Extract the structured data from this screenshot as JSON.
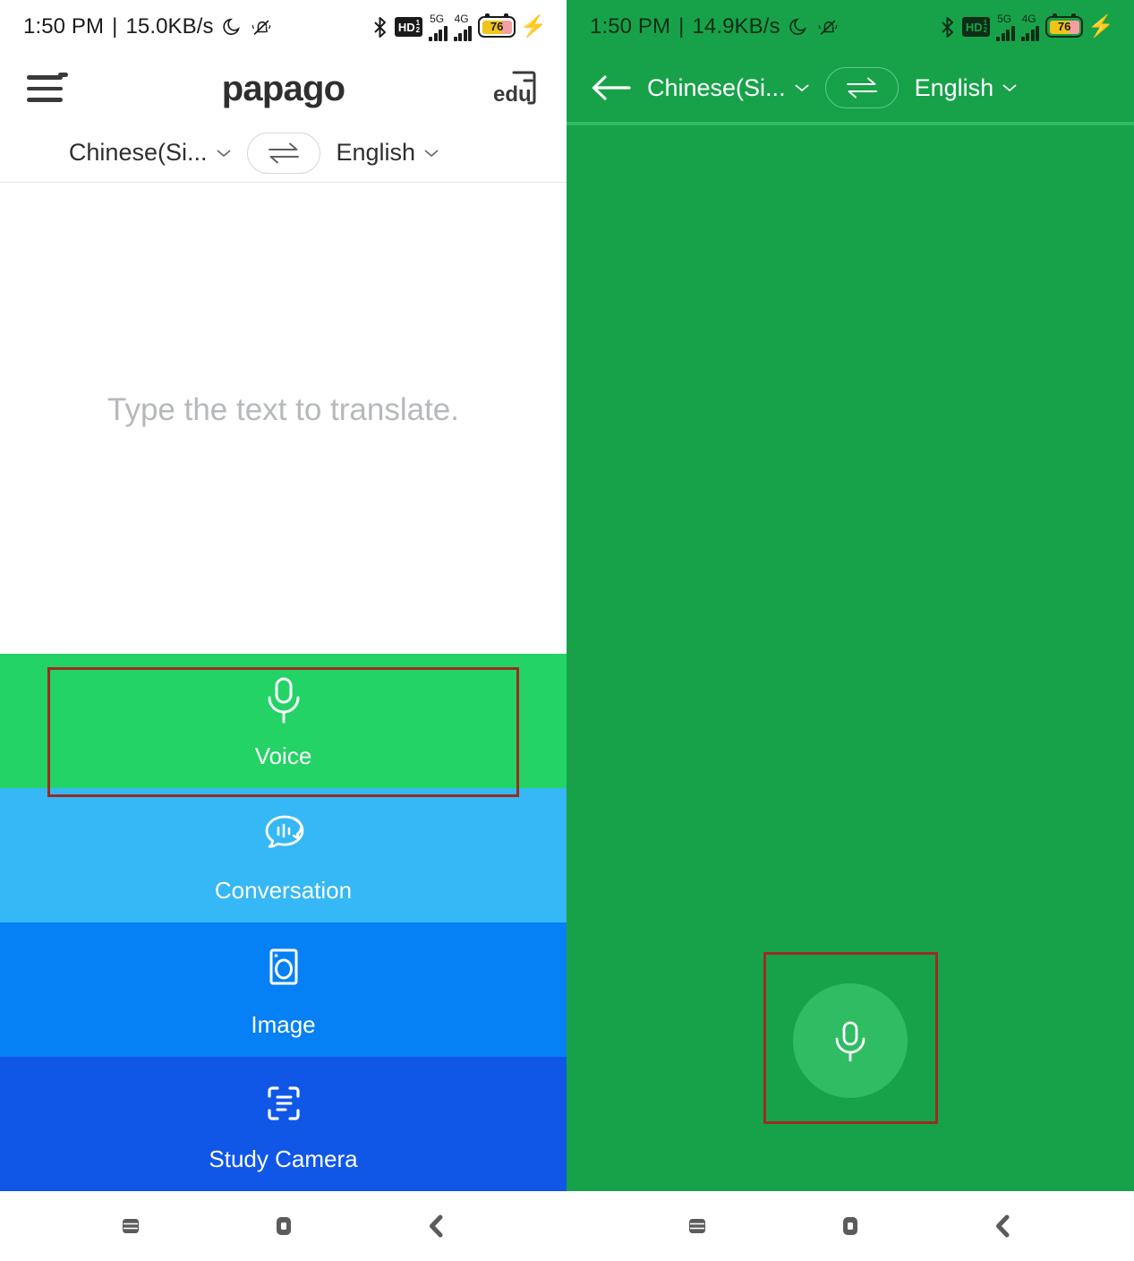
{
  "left_phone": {
    "status_bar": {
      "time": "1:50 PM",
      "separator": "|",
      "network_speed": "15.0KB/s",
      "icons": [
        "moon-icon",
        "bell-off-icon",
        "bluetooth-icon",
        "hd-icon",
        "signal-5g-icon",
        "signal-4g-icon",
        "battery-icon"
      ],
      "network_5g": "5G",
      "network_4g": "4G",
      "hd_label": "HD",
      "hd_sim": "1",
      "hd_sim2": "2",
      "battery_percent": "76"
    },
    "header": {
      "menu_icon": "hamburger-menu-icon",
      "brand": "papago",
      "edu_label": "edu"
    },
    "language_bar": {
      "source_language": "Chinese(Si...",
      "target_language": "English",
      "swap_icon": "swap-arrows-icon"
    },
    "input": {
      "placeholder": "Type the text to translate."
    },
    "actions": [
      {
        "label": "Voice",
        "icon": "microphone-icon",
        "color": "#23D365"
      },
      {
        "label": "Conversation",
        "icon": "conversation-icon",
        "color": "#35B8F5"
      },
      {
        "label": "Image",
        "icon": "camera-icon",
        "color": "#0580F5"
      },
      {
        "label": "Study Camera",
        "icon": "scan-text-icon",
        "color": "#1057E8"
      }
    ],
    "nav_bar": {
      "recents": "recent-apps-icon",
      "home": "home-icon",
      "back": "back-icon"
    }
  },
  "right_phone": {
    "status_bar": {
      "time": "1:50 PM",
      "separator": "|",
      "network_speed": "14.9KB/s",
      "network_5g": "5G",
      "network_4g": "4G",
      "hd_label": "HD",
      "hd_sim": "1",
      "hd_sim2": "2",
      "battery_percent": "76"
    },
    "header": {
      "back_icon": "back-arrow-icon",
      "source_language": "Chinese(Si...",
      "target_language": "English",
      "swap_icon": "swap-arrows-icon"
    },
    "mic_button": {
      "icon": "microphone-icon",
      "background": "#2FBC63"
    },
    "background": "#17A24A",
    "nav_bar": {
      "recents": "recent-apps-icon",
      "home": "home-icon",
      "back": "back-icon"
    }
  },
  "annotations": {
    "highlight_color": "#9B2D1F",
    "boxes": [
      {
        "name": "voice-button-highlight"
      },
      {
        "name": "mic-button-highlight"
      }
    ]
  }
}
